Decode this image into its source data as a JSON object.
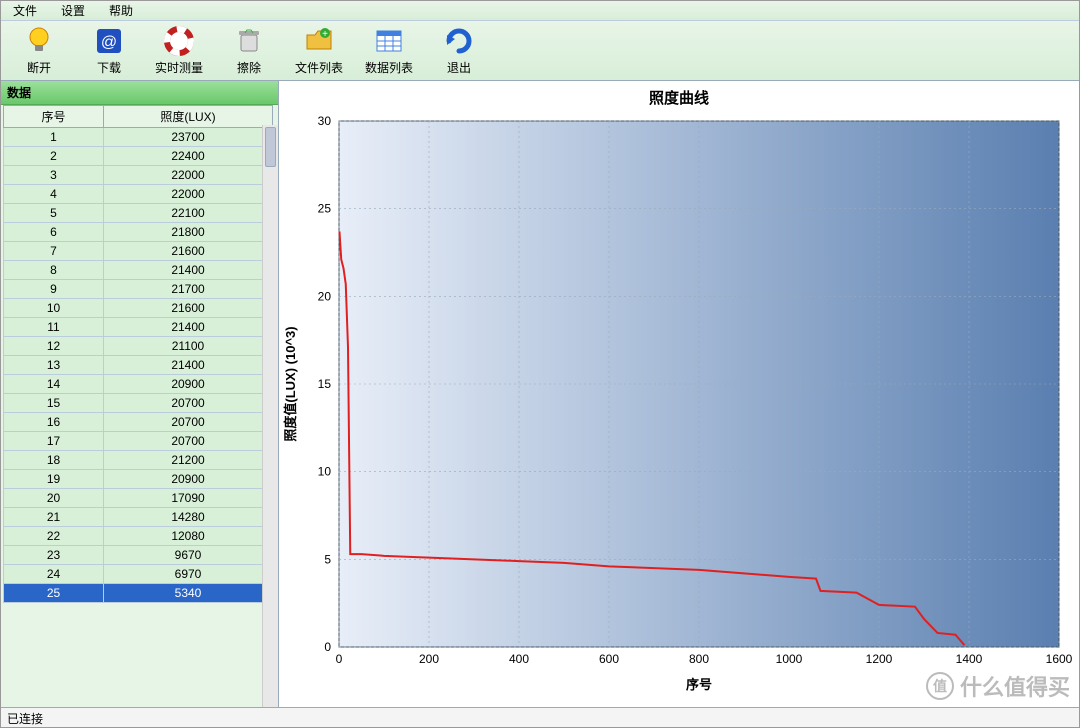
{
  "menu": {
    "file": "文件",
    "settings": "设置",
    "help": "帮助"
  },
  "toolbar": {
    "disconnect": "断开",
    "download": "下载",
    "realtime": "实时测量",
    "clear": "擦除",
    "filelist": "文件列表",
    "datalist": "数据列表",
    "exit": "退出"
  },
  "panel": {
    "title": "数据",
    "col_seq": "序号",
    "col_lux": "照度(LUX)",
    "rows": [
      {
        "seq": 1,
        "lux": 23700
      },
      {
        "seq": 2,
        "lux": 22400
      },
      {
        "seq": 3,
        "lux": 22000
      },
      {
        "seq": 4,
        "lux": 22000
      },
      {
        "seq": 5,
        "lux": 22100
      },
      {
        "seq": 6,
        "lux": 21800
      },
      {
        "seq": 7,
        "lux": 21600
      },
      {
        "seq": 8,
        "lux": 21400
      },
      {
        "seq": 9,
        "lux": 21700
      },
      {
        "seq": 10,
        "lux": 21600
      },
      {
        "seq": 11,
        "lux": 21400
      },
      {
        "seq": 12,
        "lux": 21100
      },
      {
        "seq": 13,
        "lux": 21400
      },
      {
        "seq": 14,
        "lux": 20900
      },
      {
        "seq": 15,
        "lux": 20700
      },
      {
        "seq": 16,
        "lux": 20700
      },
      {
        "seq": 17,
        "lux": 20700
      },
      {
        "seq": 18,
        "lux": 21200
      },
      {
        "seq": 19,
        "lux": 20900
      },
      {
        "seq": 20,
        "lux": 17090
      },
      {
        "seq": 21,
        "lux": 14280
      },
      {
        "seq": 22,
        "lux": 12080
      },
      {
        "seq": 23,
        "lux": 9670
      },
      {
        "seq": 24,
        "lux": 6970
      },
      {
        "seq": 25,
        "lux": 5340
      }
    ],
    "selected_index": 24
  },
  "status": {
    "text": "已连接"
  },
  "watermark": {
    "badge": "值",
    "text": "什么值得买"
  },
  "chart_data": {
    "type": "line",
    "title": "照度曲线",
    "xlabel": "序号",
    "ylabel": "照度值(LUX) (10^3)",
    "xlim": [
      0,
      1600
    ],
    "ylim": [
      0,
      30
    ],
    "xticks": [
      0,
      200,
      400,
      600,
      800,
      1000,
      1200,
      1400,
      1600
    ],
    "yticks": [
      0,
      5,
      10,
      15,
      20,
      25,
      30
    ],
    "series": [
      {
        "name": "照度",
        "color": "#e02020",
        "points": [
          {
            "x": 1,
            "y": 23.7
          },
          {
            "x": 5,
            "y": 22.1
          },
          {
            "x": 10,
            "y": 21.6
          },
          {
            "x": 15,
            "y": 20.7
          },
          {
            "x": 20,
            "y": 17.1
          },
          {
            "x": 25,
            "y": 5.3
          },
          {
            "x": 50,
            "y": 5.3
          },
          {
            "x": 100,
            "y": 5.2
          },
          {
            "x": 200,
            "y": 5.1
          },
          {
            "x": 300,
            "y": 5.0
          },
          {
            "x": 400,
            "y": 4.9
          },
          {
            "x": 500,
            "y": 4.8
          },
          {
            "x": 600,
            "y": 4.6
          },
          {
            "x": 700,
            "y": 4.5
          },
          {
            "x": 800,
            "y": 4.4
          },
          {
            "x": 900,
            "y": 4.2
          },
          {
            "x": 1000,
            "y": 4.0
          },
          {
            "x": 1060,
            "y": 3.9
          },
          {
            "x": 1070,
            "y": 3.2
          },
          {
            "x": 1150,
            "y": 3.1
          },
          {
            "x": 1200,
            "y": 2.4
          },
          {
            "x": 1280,
            "y": 2.3
          },
          {
            "x": 1300,
            "y": 1.6
          },
          {
            "x": 1330,
            "y": 0.8
          },
          {
            "x": 1370,
            "y": 0.7
          },
          {
            "x": 1390,
            "y": 0.1
          }
        ]
      }
    ]
  }
}
